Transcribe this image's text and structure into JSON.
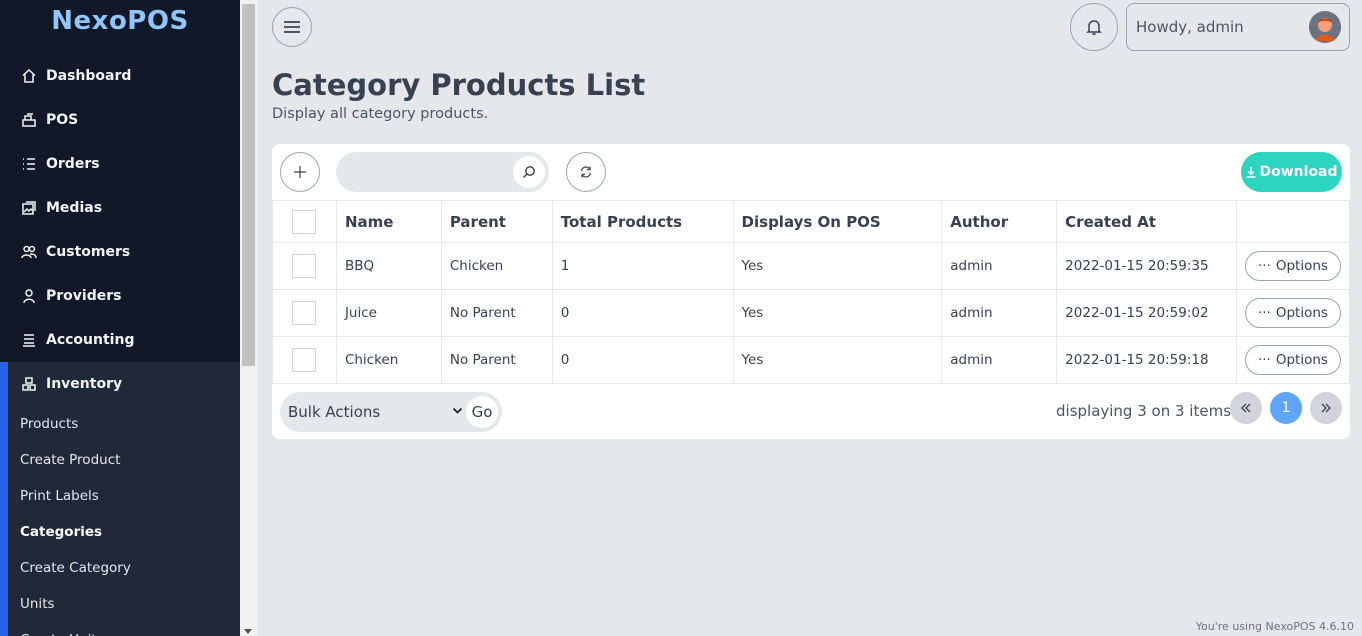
{
  "brand": {
    "name": "NexoPOS"
  },
  "sidebar": {
    "items": [
      {
        "label": "Dashboard",
        "icon": "home-icon"
      },
      {
        "label": "POS",
        "icon": "cash-register-icon"
      },
      {
        "label": "Orders",
        "icon": "list-icon"
      },
      {
        "label": "Medias",
        "icon": "images-icon"
      },
      {
        "label": "Customers",
        "icon": "users-icon"
      },
      {
        "label": "Providers",
        "icon": "user-icon"
      },
      {
        "label": "Accounting",
        "icon": "stack-icon"
      },
      {
        "label": "Inventory",
        "icon": "inventory-icon"
      }
    ],
    "submenu": [
      {
        "label": "Products"
      },
      {
        "label": "Create Product"
      },
      {
        "label": "Print Labels"
      },
      {
        "label": "Categories"
      },
      {
        "label": "Create Category"
      },
      {
        "label": "Units"
      },
      {
        "label": "Create Unit"
      }
    ]
  },
  "header": {
    "greeting": "Howdy, admin"
  },
  "page": {
    "title": "Category Products List",
    "subtitle": "Display all category products."
  },
  "toolbar": {
    "download_label": "Download",
    "search_placeholder": ""
  },
  "table": {
    "columns": [
      "Name",
      "Parent",
      "Total Products",
      "Displays On POS",
      "Author",
      "Created At"
    ],
    "rows": [
      {
        "name": "BBQ",
        "parent": "Chicken",
        "total": "1",
        "pos": "Yes",
        "author": "admin",
        "created": "2022-01-15 20:59:35",
        "options": "Options"
      },
      {
        "name": "Juice",
        "parent": "No Parent",
        "total": "0",
        "pos": "Yes",
        "author": "admin",
        "created": "2022-01-15 20:59:02",
        "options": "Options"
      },
      {
        "name": "Chicken",
        "parent": "No Parent",
        "total": "0",
        "pos": "Yes",
        "author": "admin",
        "created": "2022-01-15 20:59:18",
        "options": "Options"
      }
    ]
  },
  "footer": {
    "bulk_label": "Bulk Actions",
    "go_label": "Go",
    "page_info": "displaying 3 on 3 items",
    "current_page": "1"
  },
  "version": "You're using NexoPOS 4.6.10",
  "colors": {
    "sidebar": "#111827",
    "accent": "#2563eb",
    "download": "#2dd4bf",
    "page_active": "#60a5fa"
  }
}
